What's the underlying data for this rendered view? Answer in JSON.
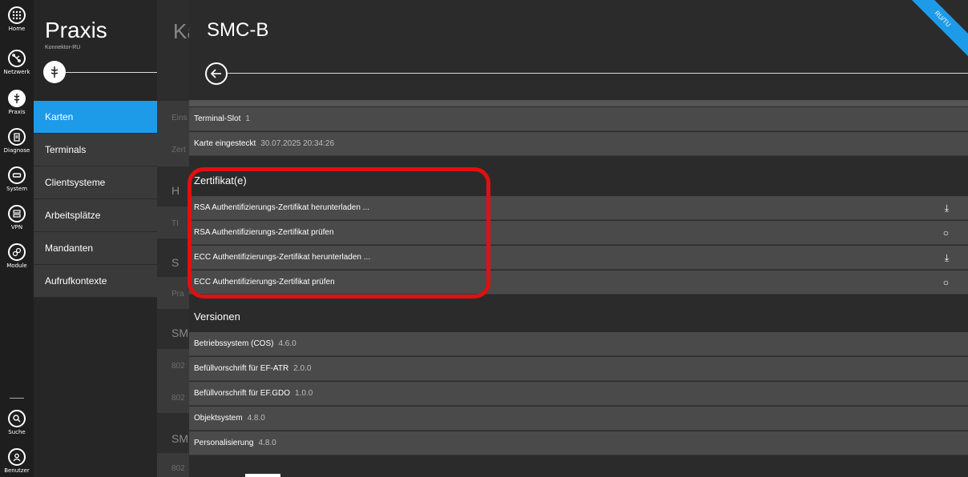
{
  "rail": {
    "items": [
      {
        "label": "Home",
        "icon": "home-grid-icon"
      },
      {
        "label": "Netzwerk",
        "icon": "network-icon"
      },
      {
        "label": "Praxis",
        "icon": "praxis-caduceus-icon"
      },
      {
        "label": "Diagnose",
        "icon": "clipboard-icon"
      },
      {
        "label": "System",
        "icon": "system-icon"
      },
      {
        "label": "VPN",
        "icon": "vpn-icon"
      },
      {
        "label": "Module",
        "icon": "modules-icon"
      },
      {
        "label": "Suche",
        "icon": "search-icon"
      },
      {
        "label": "Benutzer",
        "icon": "user-icon"
      }
    ]
  },
  "nav": {
    "title": "Praxis",
    "subtitle": "Konnektor-RU",
    "items": [
      {
        "label": "Karten"
      },
      {
        "label": "Terminals"
      },
      {
        "label": "Clientsysteme"
      },
      {
        "label": "Arbeitsplätze"
      },
      {
        "label": "Mandanten"
      },
      {
        "label": "Aufrufkontexte"
      }
    ]
  },
  "middle": {
    "title": "Ka",
    "texts": [
      "Eins",
      "Zert",
      "H",
      "TI",
      "S",
      "Pra",
      "SM",
      "802",
      "802",
      "SM",
      "802"
    ]
  },
  "panel": {
    "title": "SMC-B",
    "ribbon": "RU/TU",
    "info_rows": [
      {
        "label": "Terminal-Slot",
        "value": "1"
      },
      {
        "label": "Karte eingesteckt",
        "value": "30.07.2025 20:34:26"
      }
    ],
    "cert_section": "Zertifikat(e)",
    "cert_rows": [
      {
        "label": "RSA Authentifizierungs-Zertifikat herunterladen ...",
        "action": "⤓"
      },
      {
        "label": "RSA Authentifizierungs-Zertifikat prüfen",
        "action": "○"
      },
      {
        "label": "ECC Authentifizierungs-Zertifikat herunterladen ...",
        "action": "⤓"
      },
      {
        "label": "ECC Authentifizierungs-Zertifikat prüfen",
        "action": "○"
      }
    ],
    "versions_section": "Versionen",
    "version_rows": [
      {
        "label": "Betriebssystem (COS)",
        "value": "4.6.0"
      },
      {
        "label": "Befüllvorschrift für EF-ATR",
        "value": "2.0.0"
      },
      {
        "label": "Befüllvorschrift für EF.GDO",
        "value": "1.0.0"
      },
      {
        "label": "Objektsystem",
        "value": "4.8.0"
      },
      {
        "label": "Personalisierung",
        "value": "4.8.0"
      }
    ]
  },
  "colors": {
    "accent": "#1d9be8",
    "highlight": "#e01010"
  }
}
